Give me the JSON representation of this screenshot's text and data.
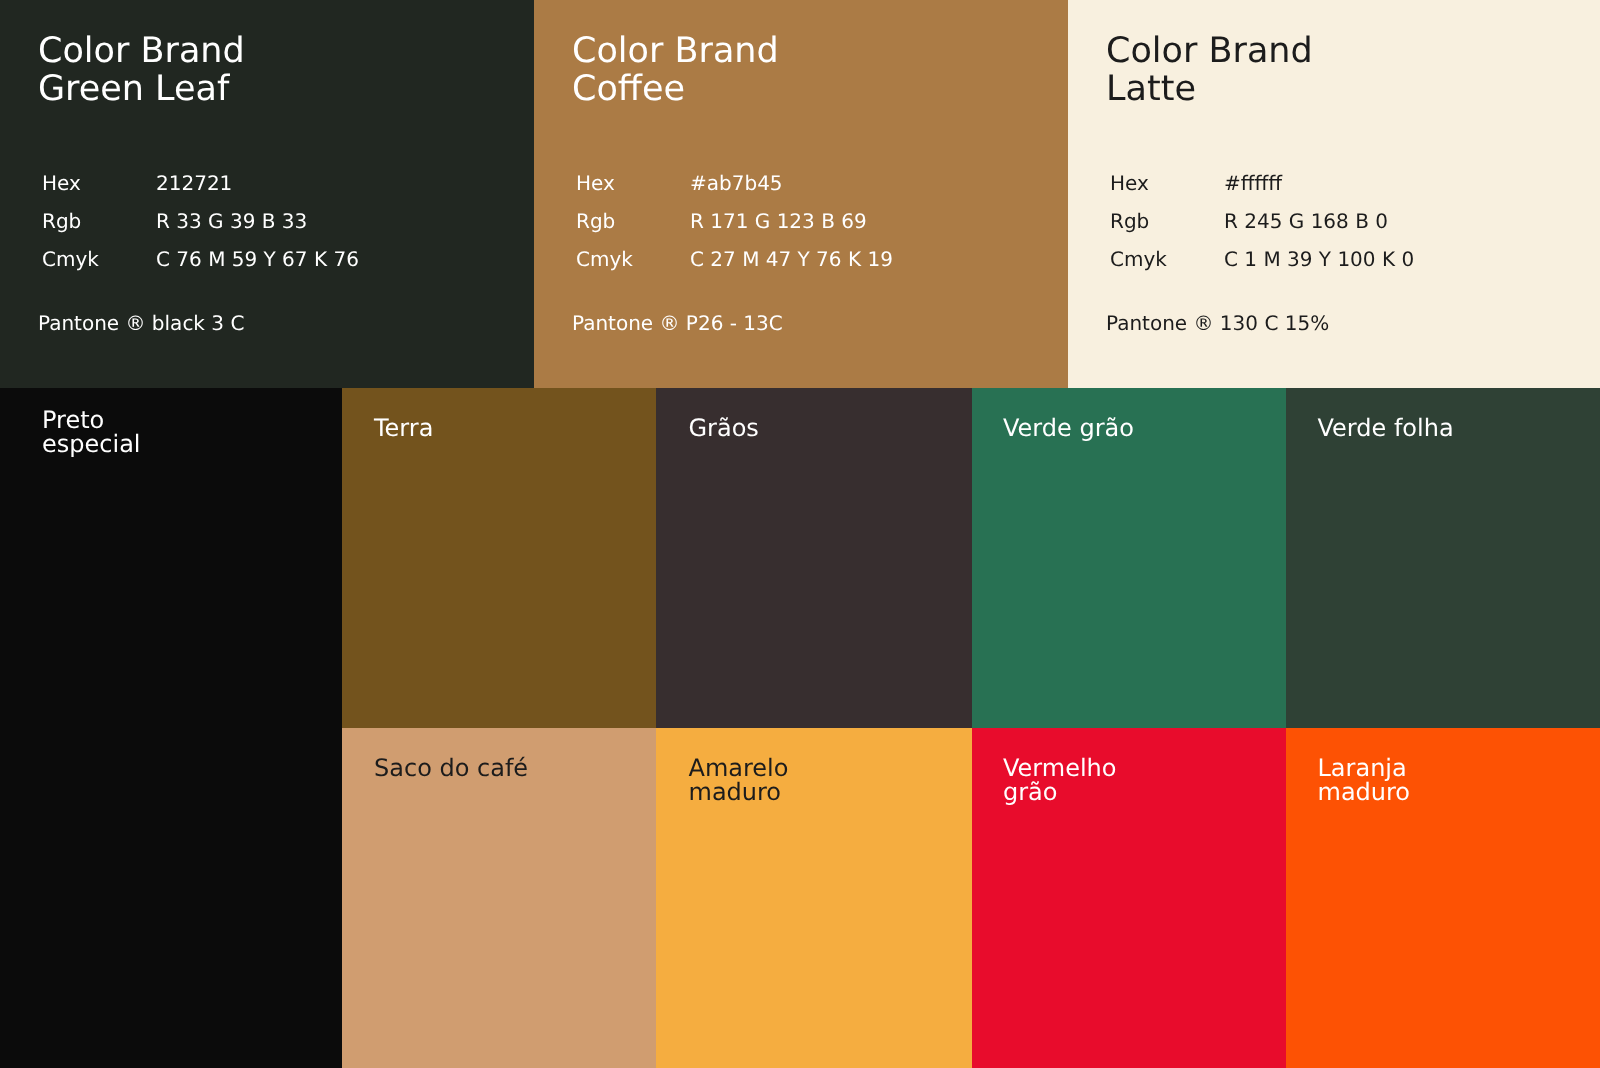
{
  "brand_colors": [
    {
      "title": "Color Brand",
      "name": "Green Leaf",
      "color": "#212721",
      "specs": [
        {
          "label": "Hex",
          "value": "212721"
        },
        {
          "label": "Rgb",
          "value": "R 33 G 39 B 33"
        },
        {
          "label": "Cmyk",
          "value": "C 76 M 59 Y 67 K 76"
        }
      ],
      "pantone": "Pantone ® black 3 C"
    },
    {
      "title": "Color Brand",
      "name": "Coffee",
      "color": "#ab7b45",
      "specs": [
        {
          "label": "Hex",
          "value": "#ab7b45"
        },
        {
          "label": "Rgb",
          "value": "R 171 G 123 B 69"
        },
        {
          "label": "Cmyk",
          "value": "C 27 M 47 Y 76 K 19"
        }
      ],
      "pantone": "Pantone ® P26 - 13C"
    },
    {
      "title": "Color Brand",
      "name": "Latte",
      "color": "#f8f0df",
      "specs": [
        {
          "label": "Hex",
          "value": "#ffffff"
        },
        {
          "label": "Rgb",
          "value": "R 245 G 168 B 0"
        },
        {
          "label": "Cmyk",
          "value": "C 1 M 39 Y 100 K 0"
        }
      ],
      "pantone": "Pantone ® 130 C 15%"
    }
  ],
  "feature_swatch": {
    "lines": [
      "Preto",
      "especial"
    ],
    "color": "#0b0b0b"
  },
  "swatches": [
    {
      "lines": [
        "Terra"
      ],
      "color": "#73531d"
    },
    {
      "lines": [
        "Grãos"
      ],
      "color": "#372e2f"
    },
    {
      "lines": [
        "Verde grão"
      ],
      "color": "#287153"
    },
    {
      "lines": [
        "Verde folha"
      ],
      "color": "#2f4135"
    },
    {
      "lines": [
        "Saco do café"
      ],
      "color": "#d09d70"
    },
    {
      "lines": [
        "Amarelo",
        "maduro"
      ],
      "color": "#f5ad40"
    },
    {
      "lines": [
        "Vermelho",
        "grão"
      ],
      "color": "#e80c2c"
    },
    {
      "lines": [
        "Laranja",
        "maduro"
      ],
      "color": "#fd5204"
    }
  ]
}
